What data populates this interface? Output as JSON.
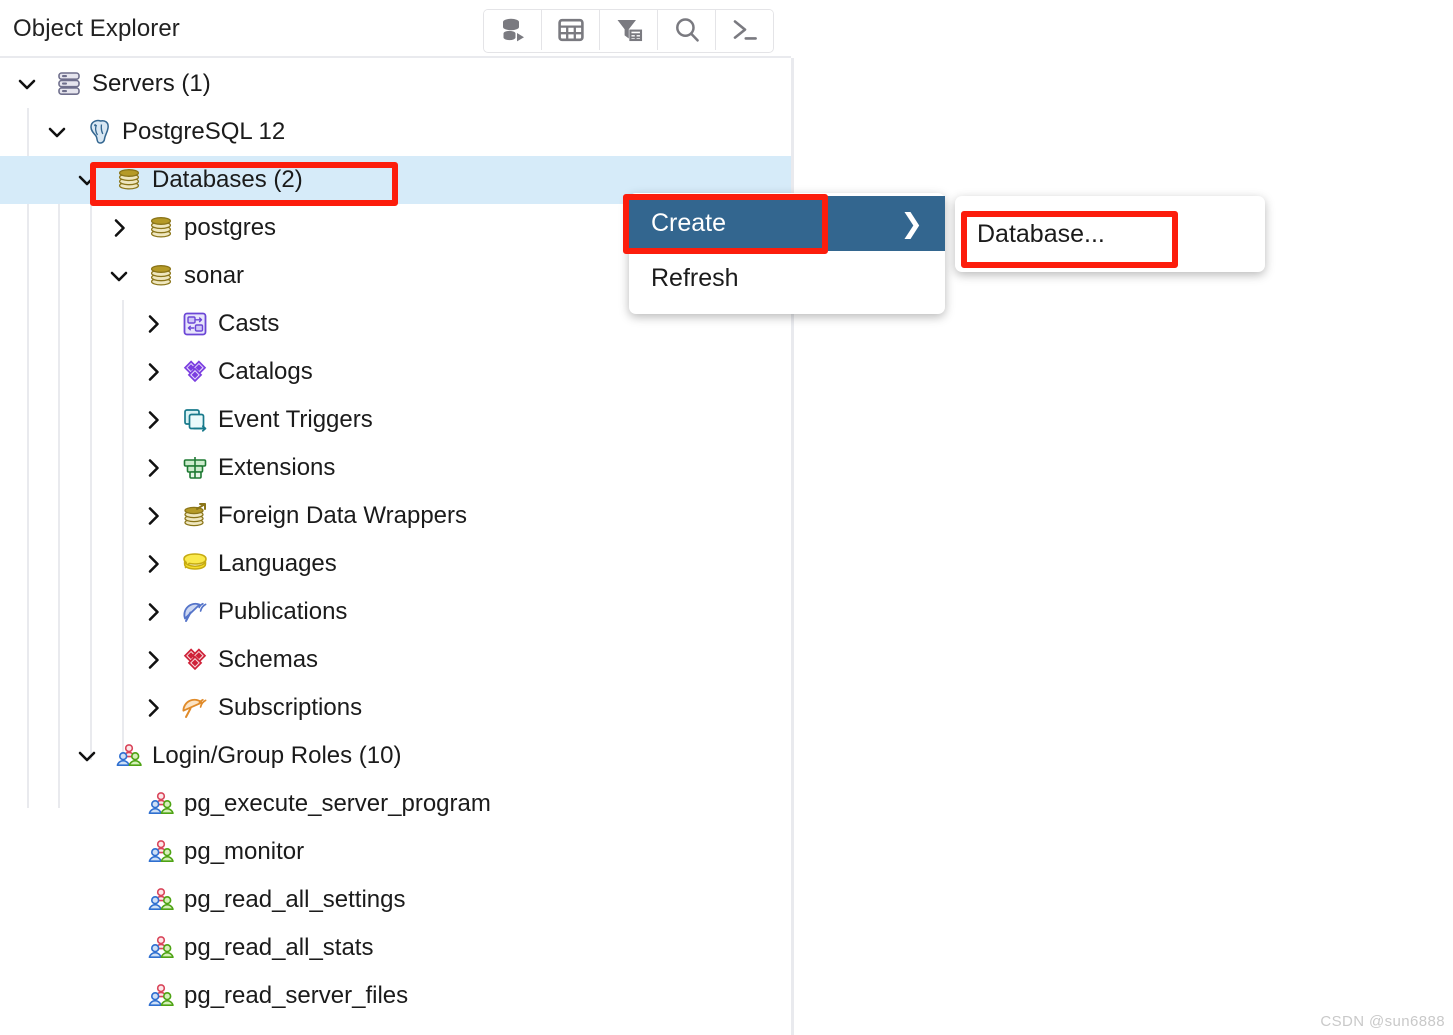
{
  "panel": {
    "title": "Object Explorer",
    "toolbar": [
      {
        "name": "object-explorer-icon",
        "title": "Object Explorer"
      },
      {
        "name": "grid-table-icon",
        "title": "Grid"
      },
      {
        "name": "filter-table-icon",
        "title": "Filter"
      },
      {
        "name": "search-icon",
        "title": "Search"
      },
      {
        "name": "terminal-icon",
        "title": "Terminal"
      }
    ]
  },
  "tree": {
    "rows": [
      {
        "label": "Servers (1)",
        "icon": "servers-icon",
        "caret": "down",
        "depth": 0,
        "selected": false
      },
      {
        "label": "PostgreSQL 12",
        "icon": "postgresql-elephant-icon",
        "caret": "down",
        "depth": 1,
        "selected": false
      },
      {
        "label": "Databases (2)",
        "icon": "databases-icon",
        "caret": "down",
        "depth": 2,
        "selected": true
      },
      {
        "label": "postgres",
        "icon": "database-icon",
        "caret": "right",
        "depth": 3,
        "selected": false
      },
      {
        "label": "sonar",
        "icon": "database-icon",
        "caret": "down",
        "depth": 3,
        "selected": false
      },
      {
        "label": "Casts",
        "icon": "casts-icon",
        "caret": "right",
        "depth": 4,
        "selected": false
      },
      {
        "label": "Catalogs",
        "icon": "catalogs-icon",
        "caret": "right",
        "depth": 4,
        "selected": false
      },
      {
        "label": "Event Triggers",
        "icon": "event-triggers-icon",
        "caret": "right",
        "depth": 4,
        "selected": false
      },
      {
        "label": "Extensions",
        "icon": "extensions-icon",
        "caret": "right",
        "depth": 4,
        "selected": false
      },
      {
        "label": "Foreign Data Wrappers",
        "icon": "foreign-data-wrappers-icon",
        "caret": "right",
        "depth": 4,
        "selected": false
      },
      {
        "label": "Languages",
        "icon": "languages-icon",
        "caret": "right",
        "depth": 4,
        "selected": false
      },
      {
        "label": "Publications",
        "icon": "publications-icon",
        "caret": "right",
        "depth": 4,
        "selected": false
      },
      {
        "label": "Schemas",
        "icon": "schemas-icon",
        "caret": "right",
        "depth": 4,
        "selected": false
      },
      {
        "label": "Subscriptions",
        "icon": "subscriptions-icon",
        "caret": "right",
        "depth": 4,
        "selected": false
      },
      {
        "label": "Login/Group Roles (10)",
        "icon": "group-roles-icon",
        "caret": "down",
        "depth": 2,
        "selected": false
      },
      {
        "label": "pg_execute_server_program",
        "icon": "role-icon",
        "caret": "none",
        "depth": 3,
        "selected": false
      },
      {
        "label": "pg_monitor",
        "icon": "role-icon",
        "caret": "none",
        "depth": 3,
        "selected": false
      },
      {
        "label": "pg_read_all_settings",
        "icon": "role-icon",
        "caret": "none",
        "depth": 3,
        "selected": false
      },
      {
        "label": "pg_read_all_stats",
        "icon": "role-icon",
        "caret": "none",
        "depth": 3,
        "selected": false
      },
      {
        "label": "pg_read_server_files",
        "icon": "role-icon",
        "caret": "none",
        "depth": 3,
        "selected": false
      }
    ]
  },
  "context_menu": {
    "items": [
      {
        "label": "Create",
        "active": true,
        "submenu_arrow": "❯"
      },
      {
        "label": "Refresh",
        "active": false,
        "submenu_arrow": ""
      }
    ]
  },
  "sub_menu": {
    "items": [
      {
        "label": "Database..."
      }
    ]
  },
  "annotations": {
    "highlight_color": "#fc1d0c",
    "boxes": [
      "databases-row",
      "create-menu-item",
      "database-submenu-item"
    ]
  },
  "watermark": "CSDN @sun6888"
}
